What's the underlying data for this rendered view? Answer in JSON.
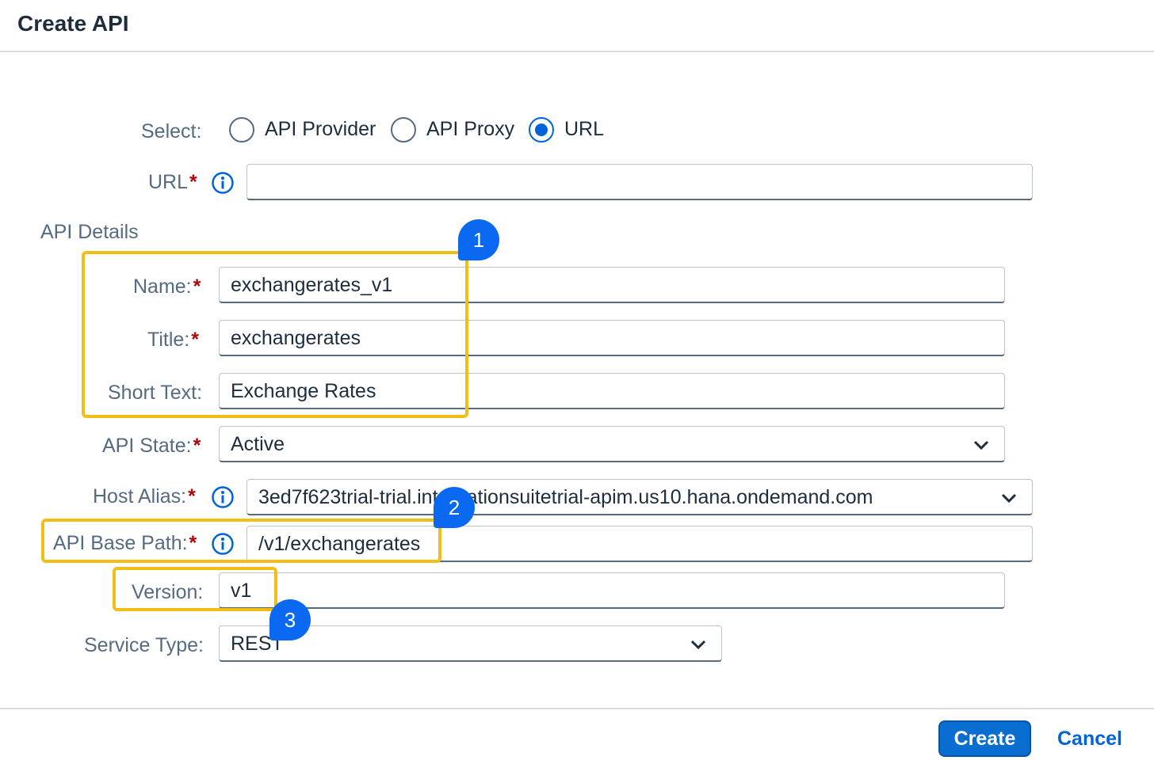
{
  "dialog": {
    "title": "Create API"
  },
  "select": {
    "label": "Select:",
    "options": [
      "API Provider",
      "API Proxy",
      "URL"
    ],
    "selected": "URL"
  },
  "url": {
    "label": "URL",
    "value": ""
  },
  "api_details": {
    "heading": "API Details",
    "name": {
      "label": "Name:",
      "value": "exchangerates_v1"
    },
    "title": {
      "label": "Title:",
      "value": "exchangerates"
    },
    "short_text": {
      "label": "Short Text:",
      "value": "Exchange Rates"
    },
    "api_state": {
      "label": "API State:",
      "value": "Active"
    },
    "host_alias": {
      "label": "Host Alias:",
      "value": "3ed7f623trial-trial.integrationsuitetrial-apim.us10.hana.ondemand.com"
    },
    "base_path": {
      "label": "API Base Path:",
      "value": "/v1/exchangerates"
    },
    "version": {
      "label": "Version:",
      "value": "v1"
    },
    "service_type": {
      "label": "Service Type:",
      "value": "REST"
    }
  },
  "required_marker": "*",
  "callouts": [
    "1",
    "2",
    "3"
  ],
  "footer": {
    "create_label": "Create",
    "cancel_label": "Cancel"
  },
  "colors": {
    "accent": "#0a6ed1",
    "highlight": "#f2be16",
    "required": "#aa0808",
    "callout": "#0a69f0"
  }
}
